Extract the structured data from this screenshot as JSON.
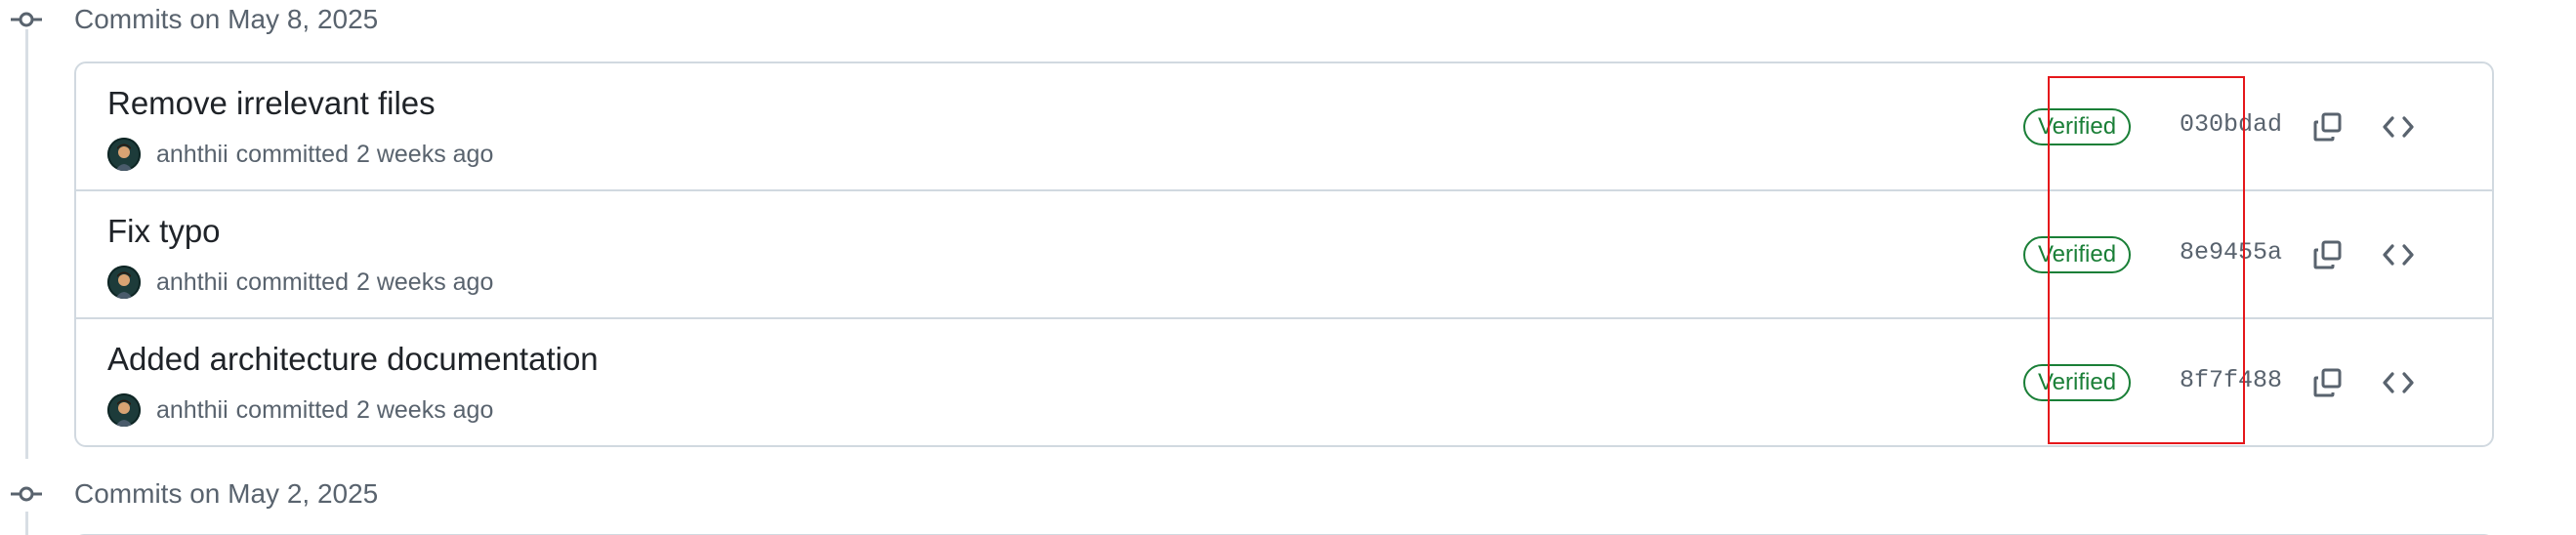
{
  "groups": [
    {
      "title": "Commits on May 8, 2025",
      "commits": [
        {
          "title": "Remove irrelevant files",
          "author": "anhthii",
          "action": "committed",
          "time": "2 weeks ago",
          "badge": "Verified",
          "sha": "030bdad"
        },
        {
          "title": "Fix typo",
          "author": "anhthii",
          "action": "committed",
          "time": "2 weeks ago",
          "badge": "Verified",
          "sha": "8e9455a"
        },
        {
          "title": "Added architecture documentation",
          "author": "anhthii",
          "action": "committed",
          "time": "2 weeks ago",
          "badge": "Verified",
          "sha": "8f7f488"
        }
      ]
    },
    {
      "title": "Commits on May 2, 2025",
      "commits": []
    }
  ],
  "icons": {
    "commit_node": "git-commit-icon",
    "copy": "copy-icon",
    "browse": "code-icon",
    "avatar": "avatar"
  },
  "colors": {
    "verified": "#1a7f37",
    "muted_text": "#59636e",
    "border": "#d1d9e0",
    "highlight": "#e5171b"
  }
}
